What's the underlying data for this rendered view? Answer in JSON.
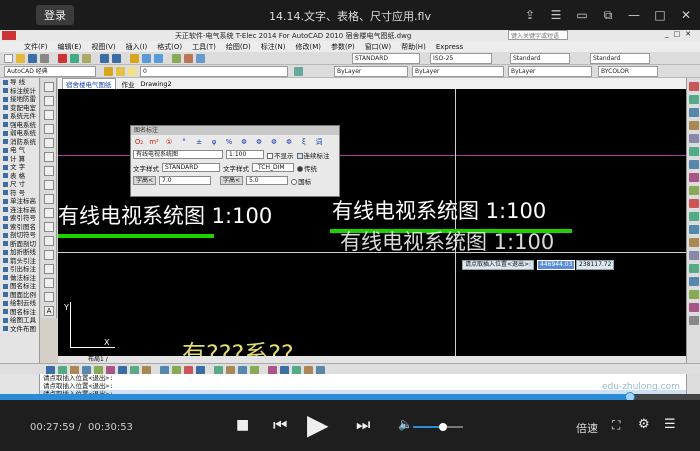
{
  "player": {
    "login_label": "登录",
    "title": "14.14.文字、表格、尺寸应用.flv",
    "top_icons": [
      "share-icon",
      "list-icon",
      "mini-icon",
      "window-icon",
      "minimize-icon",
      "maximize-icon",
      "close-icon"
    ],
    "time_current": "00:27:59",
    "time_total": "00:30:53",
    "progress": 0.9,
    "volume": 0.6,
    "speed_label": "倍速",
    "watermark": "edu-zhulong.com"
  },
  "cad": {
    "app_title": "天正软件-电气系统 T-Elec 2014   For AutoCAD 2010     宿舍楼电气图纸.dwg",
    "search_placeholder": "键入关键字或短语",
    "menu": [
      "文件(F)",
      "编辑(E)",
      "视图(V)",
      "插入(I)",
      "格式(O)",
      "工具(T)",
      "绘图(D)",
      "标注(N)",
      "修改(M)",
      "参数(P)",
      "窗口(W)",
      "帮助(H)",
      "Express"
    ],
    "toolbar_combos": {
      "workspace": "AutoCAD 经典",
      "textstyle": "STANDARD",
      "dimstyle": "ISO-25",
      "tablestyle": "Standard",
      "mleaderstyle": "Standard",
      "layer": "ByLayer",
      "linetype": "ByLayer",
      "lineweight": "ByLayer",
      "color": "BYCOLOR"
    },
    "left_panel": [
      "导   线",
      "标注统计",
      "接地防雷",
      "变配电室",
      "系统元件",
      "强电系统",
      "弱电系统",
      "消防系统",
      "电   气",
      "计   算",
      "文   字",
      "表   格",
      "尺   寸",
      "符   号",
      "单注标高",
      "连注标高",
      "索引符号",
      "索引图名",
      "剖切符号",
      "断面剖切",
      "加折断线",
      "箭头引注",
      "引出标注",
      "做法标注",
      "图名标注",
      "图面比例",
      "绘制云线",
      "图名标注",
      "绘图工具",
      "文件布图"
    ],
    "tabs": [
      "宿舍楼电气图纸",
      "作业",
      "Drawing2"
    ],
    "drawing": {
      "text_left": "有线电视系统图  1:100",
      "text_right_1": "有线电视系统图  1:100",
      "text_right_2": "有线电视系统图  1:100",
      "text_bottom": "有???系??",
      "tip_prompt": "请点取插入位置<退出>:",
      "tip_x": "446944.03",
      "tip_y": "238117.72",
      "ucs_x": "X",
      "ucs_y": "Y"
    },
    "dialog": {
      "title": "图名标注",
      "name_value": "有线电视系统图",
      "scale_value": "1:100",
      "hide_label": "不显示",
      "continuous_label": "连续标注",
      "text_style_label": "文字样式",
      "text_style_value": "STANDARD",
      "text_style2_label": "文字样式",
      "text_style2_value": "_TCH_DIM",
      "traditional_label": "传统",
      "height_label": "字高<",
      "height_value": "7.0",
      "height2_label": "字高<",
      "height2_value": "5.0",
      "national_label": "国标",
      "symbols": [
        "O₂",
        "m²",
        "①",
        "°",
        "±",
        "φ",
        "%",
        "Φ",
        "Φ",
        "Φ",
        "Φ",
        "ξ",
        "词"
      ]
    },
    "bottom_tabs": "布局1 /",
    "command_lines": [
      "请点取插入位置<退出>:",
      "请点取插入位置<退出>:",
      "请点取插入位置<退出>:"
    ]
  }
}
